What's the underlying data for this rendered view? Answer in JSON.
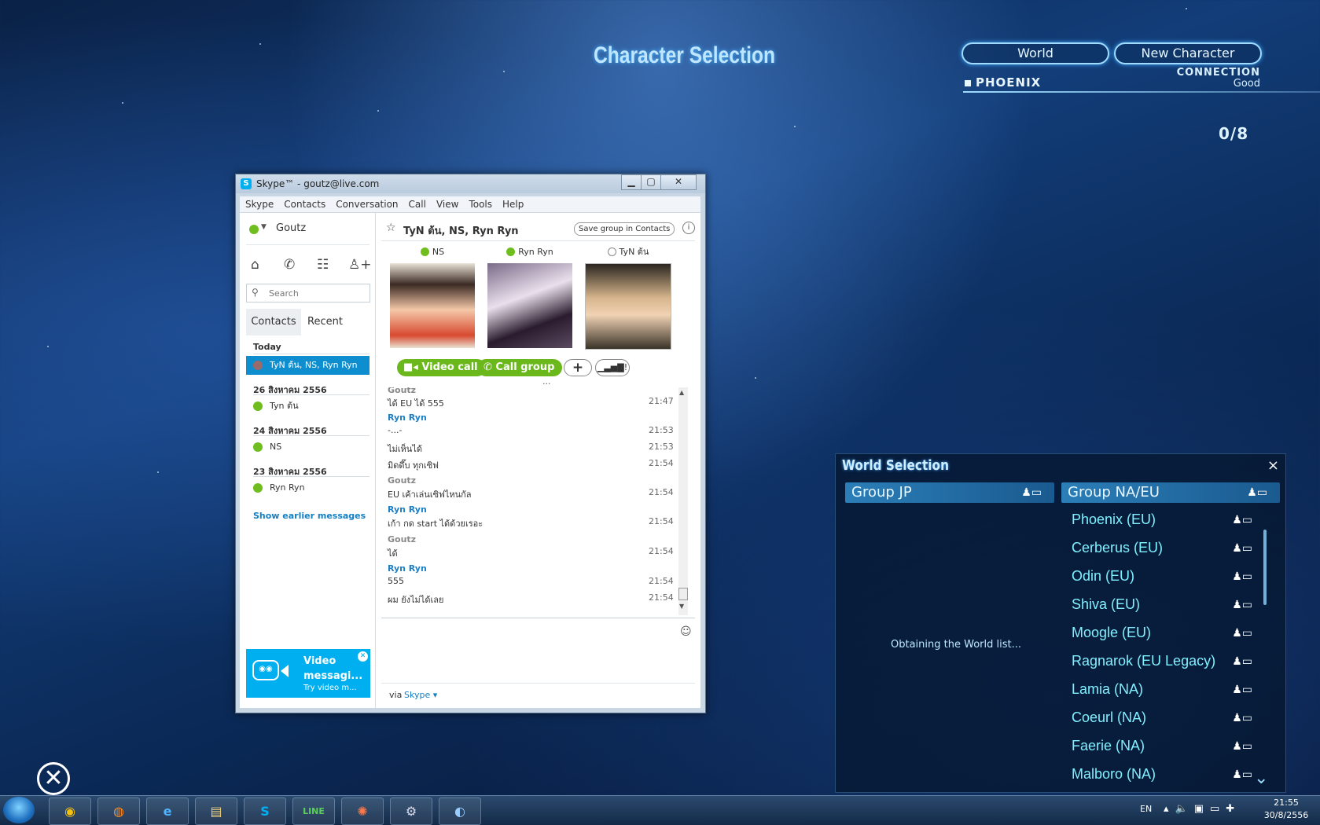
{
  "game": {
    "title": "Character Selection",
    "world_button": "World",
    "new_character_button": "New Character",
    "server_name": "PHOENIX",
    "connection_label": "CONNECTION",
    "connection_status": "Good",
    "character_count": "0/8"
  },
  "world_selection": {
    "title": "World Selection",
    "close": "×",
    "groups": [
      "Group JP",
      "Group NA/EU"
    ],
    "loading_text": "Obtaining the World list...",
    "servers": [
      "Phoenix (EU)",
      "Cerberus (EU)",
      "Odin (EU)",
      "Shiva (EU)",
      "Moogle (EU)",
      "Ragnarok (EU Legacy)",
      "Lamia (NA)",
      "Coeurl (NA)",
      "Faerie (NA)",
      "Malboro (NA)"
    ]
  },
  "skype": {
    "window_title": "Skype™ - goutz@live.com",
    "menu": [
      "Skype",
      "Contacts",
      "Conversation",
      "Call",
      "View",
      "Tools",
      "Help"
    ],
    "user_name": "Goutz",
    "search_placeholder": "Search",
    "tabs": {
      "contacts": "Contacts",
      "recent": "Recent"
    },
    "recent_groups": [
      {
        "date": "Today",
        "item": "TyN ต้น, NS, Ryn Ryn"
      },
      {
        "date": "26 สิงหาคม 2556",
        "item": "Tyn ต้น"
      },
      {
        "date": "24 สิงหาคม 2556",
        "item": "NS"
      },
      {
        "date": "23 สิงหาคม 2556",
        "item": "Ryn Ryn"
      }
    ],
    "show_earlier": "Show earlier messages",
    "ad": {
      "title": "Video messagi...",
      "subtitle": "Try video m..."
    },
    "conversation": {
      "title": "TyN ต้น, NS, Ryn Ryn",
      "save_group_button": "Save group in Contacts",
      "participants": [
        "NS",
        "Ryn Ryn",
        "TyN ต้น"
      ],
      "video_call_button": "Video call",
      "call_group_button": "Call group",
      "add_button": "+",
      "more": "...",
      "messages": [
        {
          "sender": "Goutz",
          "text": "ได้ EU ได้ 555",
          "time": "21:47"
        },
        {
          "sender": "Ryn Ryn",
          "text": "-...-",
          "time": "21:53"
        },
        {
          "sender": "",
          "text": "ไม่เห็นได้",
          "time": "21:53"
        },
        {
          "sender": "",
          "text": "มิดดึ๊บ ทุกเซิฟ",
          "time": "21:54"
        },
        {
          "sender": "Goutz",
          "text": "EU เค้าเล่นเซิฟไหนกัล",
          "time": "21:54"
        },
        {
          "sender": "Ryn Ryn",
          "text": "เก้า กด start ได้ด้วยเรอะ",
          "time": "21:54"
        },
        {
          "sender": "Goutz",
          "text": "ได้",
          "time": "21:54"
        },
        {
          "sender": "Ryn Ryn",
          "text": "555",
          "time": "21:54"
        },
        {
          "sender": "",
          "text": "ผม ยังไม่ได้เลย",
          "time": "21:54"
        }
      ],
      "via_label": "via",
      "via_service": "Skype ▾"
    },
    "colors": {
      "accent": "#00aff0",
      "green": "#6ab81c",
      "sender_blue": "#1e7fc4",
      "sender_gray": "#888888"
    }
  },
  "taskbar": {
    "apps": [
      "chrome",
      "firefox",
      "internet-explorer",
      "file-explorer",
      "skype",
      "LINE",
      "game-launcher",
      "steam",
      "media-player"
    ],
    "line_label": "LINE",
    "language": "EN",
    "time": "21:55",
    "date": "30/8/2556"
  }
}
